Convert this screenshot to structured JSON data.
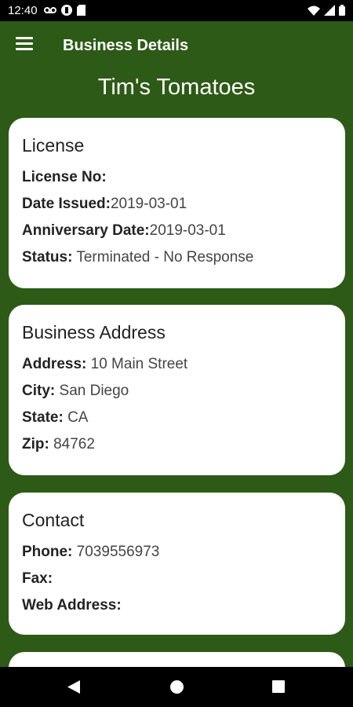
{
  "status_bar": {
    "time": "12:40",
    "icons_left": [
      "voicemail-icon",
      "circle-badge-icon",
      "sd-card-icon"
    ],
    "icons_right": [
      "wifi-icon",
      "signal-icon",
      "battery-icon"
    ]
  },
  "app_bar": {
    "title": "Business Details",
    "menu_icon": "menu-icon"
  },
  "business_name": "Tim's Tomatoes",
  "license": {
    "title": "License",
    "license_no_label": "License No:",
    "license_no_value": "",
    "date_issued_label": "Date Issued:",
    "date_issued_value": "2019-03-01",
    "anniversary_label": "Anniversary Date:",
    "anniversary_value": "2019-03-01",
    "status_label": "Status:",
    "status_value": "Terminated - No Response"
  },
  "address": {
    "title": "Business Address",
    "address_label": "Address:",
    "address_value": "10 Main Street",
    "city_label": "City:",
    "city_value": "San Diego",
    "state_label": "State:",
    "state_value": "CA",
    "zip_label": "Zip:",
    "zip_value": "84762"
  },
  "contact": {
    "title": "Contact",
    "phone_label": "Phone:",
    "phone_value": "7039556973",
    "fax_label": "Fax:",
    "fax_value": "",
    "web_label": "Web Address:",
    "web_value": ""
  },
  "colors": {
    "primary_green": "#2d5a16",
    "card_background": "#ffffff",
    "status_bar": "#000000"
  }
}
